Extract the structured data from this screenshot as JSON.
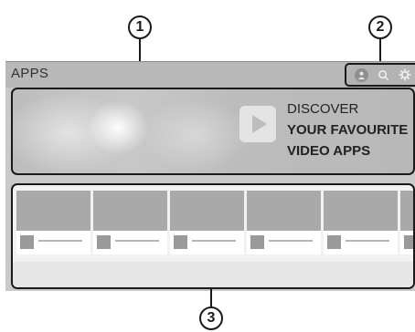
{
  "callouts": [
    "1",
    "2",
    "3"
  ],
  "header": {
    "title": "APPS",
    "icons": [
      "profile-icon",
      "search-icon",
      "settings-gear-icon"
    ]
  },
  "banner": {
    "line1": "DISCOVER",
    "line2": "YOUR FAVOURITE",
    "line3": "VIDEO APPS",
    "icon": "play-icon"
  },
  "app_tiles": [
    {
      "name": ""
    },
    {
      "name": ""
    },
    {
      "name": ""
    },
    {
      "name": ""
    },
    {
      "name": ""
    },
    {
      "name": ""
    }
  ]
}
